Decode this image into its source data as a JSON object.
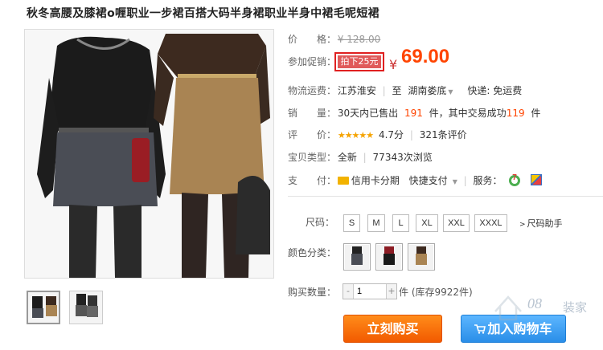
{
  "product": {
    "title": "秋冬高腰及膝裙o喱职业一步裙百搭大码半身裙职业半身中裙毛呢短裙"
  },
  "details": {
    "price_label": "价　　格：",
    "original_price": "¥ 128.00",
    "promo_label": "参加促销：",
    "promo_tag": "拍下25元",
    "currency": "¥",
    "promo_price": "69.00",
    "shipping_label": "物流运费：",
    "ship_from": "江苏淮安",
    "ship_to_prefix": "至",
    "ship_to": "湖南娄底",
    "express": "快递: 免运费",
    "sales_label": "销　　量：",
    "sales_prefix": "30天内已售出",
    "sales_count": "191",
    "sales_mid": "件，其中交易成功",
    "sales_success": "119",
    "sales_suffix": "件",
    "rating_label": "评　　价：",
    "stars": "★★★★★",
    "rating_score": "4.7分",
    "review_count": "321条评价",
    "type_label": "宝贝类型：",
    "item_type": "全新",
    "views": "77343次浏览",
    "pay_label": "支　　付：",
    "pay_card": "信用卡分期",
    "pay_quick": "快捷支付",
    "service_label": "服务："
  },
  "options": {
    "size_label": "尺码：",
    "sizes": [
      "S",
      "M",
      "L",
      "XL",
      "XXL",
      "XXXL"
    ],
    "size_help": "尺码助手",
    "color_label": "颜色分类：",
    "qty_label": "购买数量：",
    "qty_value": "1",
    "qty_minus": "-",
    "qty_plus": "+",
    "stock_text": "件 (库存9922件)"
  },
  "actions": {
    "buy_now": "立刻购买",
    "add_to_cart": "加入购物车"
  },
  "watermark": {
    "text1": "08",
    "text2": "装家"
  },
  "colors": {
    "accent_orange": "#f25a00",
    "price_red": "#ff4400",
    "promo_border": "#e02020",
    "cart_blue": "#2a8ee8"
  }
}
